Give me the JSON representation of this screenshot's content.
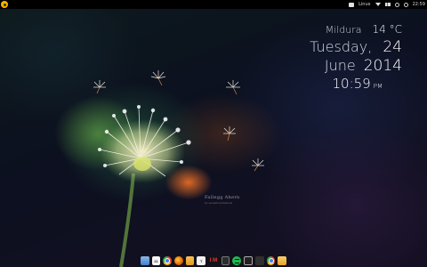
{
  "top_panel": {
    "keyboard_layout": "Linux",
    "clock": "22:59",
    "icons": [
      "app-menu-icon",
      "dropbox-icon",
      "keyboard-icon",
      "wifi-icon",
      "volume-icon",
      "notifications-icon",
      "power-icon"
    ]
  },
  "widget": {
    "city": "Mildura",
    "temperature": "14 °C",
    "weekday": "Tuesday,",
    "day": "24",
    "month": "June",
    "year": "2014",
    "time": "10:59",
    "ampm": "PM"
  },
  "wallpaper": {
    "credit": "Fallegg Ahern",
    "credit_sub": "by sevenfoundations"
  },
  "dock": {
    "items": [
      {
        "name": "finder",
        "label": ""
      },
      {
        "name": "calendar",
        "label": "31"
      },
      {
        "name": "chrome",
        "label": ""
      },
      {
        "name": "firefox",
        "label": ""
      },
      {
        "name": "files",
        "label": ""
      },
      {
        "name": "text-editor",
        "label": "T"
      },
      {
        "name": "im",
        "label": "I M"
      },
      {
        "name": "terminal",
        "label": ""
      },
      {
        "name": "spotify",
        "label": ""
      },
      {
        "name": "system-monitor",
        "label": ""
      },
      {
        "name": "workspace-switcher",
        "label": ""
      },
      {
        "name": "chrome-2",
        "label": ""
      },
      {
        "name": "folder",
        "label": ""
      }
    ]
  }
}
